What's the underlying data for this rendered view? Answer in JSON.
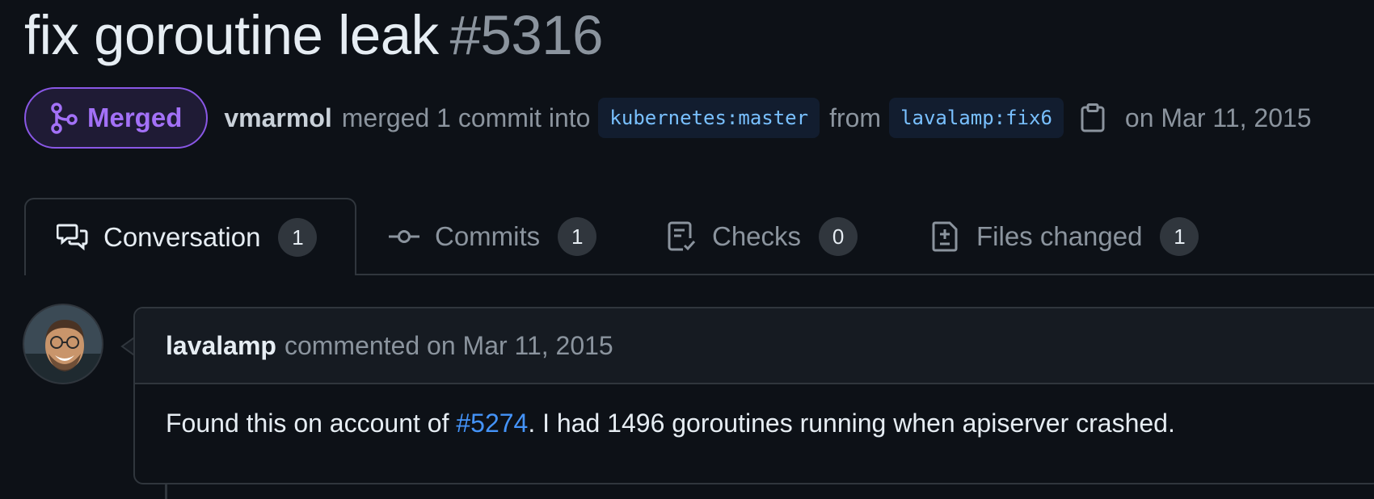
{
  "pr": {
    "title": "fix goroutine leak",
    "number": "#5316",
    "state": "Merged",
    "merged_by": "vmarmol",
    "merge_text_1": "merged 1 commit into",
    "base_branch": "kubernetes:master",
    "from_text": "from",
    "head_branch": "lavalamp:fix6",
    "date_text": "on Mar 11, 2015"
  },
  "tabs": [
    {
      "label": "Conversation",
      "count": "1",
      "icon": "comment-discussion-icon"
    },
    {
      "label": "Commits",
      "count": "1",
      "icon": "git-commit-icon"
    },
    {
      "label": "Checks",
      "count": "0",
      "icon": "checklist-icon"
    },
    {
      "label": "Files changed",
      "count": "1",
      "icon": "file-diff-icon"
    }
  ],
  "comment": {
    "author": "lavalamp",
    "meta": "commented on Mar 11, 2015",
    "body_prefix": "Found this on account of",
    "issue_link": "#5274",
    "body_suffix": ". I had 1496 goroutines running when apiserver crashed."
  },
  "colors": {
    "background": "#0d1117",
    "merged": "#a371f7",
    "link": "#4493f8",
    "branch_text": "#79c0ff"
  }
}
